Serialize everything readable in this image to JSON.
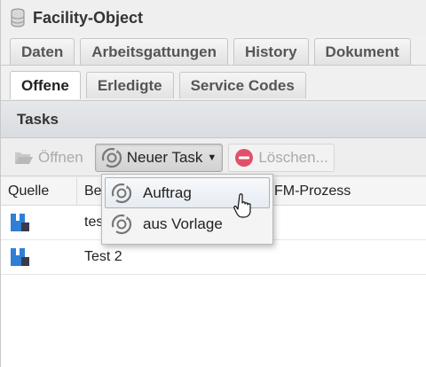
{
  "window": {
    "title": "Facility-Object",
    "title_icon": "database-icon"
  },
  "tabs_primary": [
    {
      "label": "Daten",
      "active": false
    },
    {
      "label": "Arbeitsgattungen",
      "active": false
    },
    {
      "label": "History",
      "active": false
    },
    {
      "label": "Dokument",
      "active": false
    }
  ],
  "tabs_secondary": [
    {
      "label": "Offene",
      "active": true
    },
    {
      "label": "Erledigte",
      "active": false
    },
    {
      "label": "Service Codes",
      "active": false
    }
  ],
  "tasks": {
    "header": "Tasks"
  },
  "toolbar": {
    "open_label": "Öffnen",
    "new_task_label": "Neuer Task",
    "delete_label": "Löschen..."
  },
  "grid": {
    "columns": [
      "Quelle",
      "Be",
      "FM-Prozess"
    ],
    "rows": [
      {
        "quelle_icon": "source-icon",
        "bezeichnung": "tes",
        "fm_prozess": ""
      },
      {
        "quelle_icon": "source-icon",
        "bezeichnung": "Test 2",
        "fm_prozess": ""
      }
    ]
  },
  "dropdown": {
    "items": [
      {
        "label": "Auftrag",
        "hovered": true
      },
      {
        "label": "aus Vorlage",
        "hovered": false
      }
    ]
  },
  "colors": {
    "accent_blue": "#2f7fd6",
    "delete_red": "#e0506a"
  }
}
